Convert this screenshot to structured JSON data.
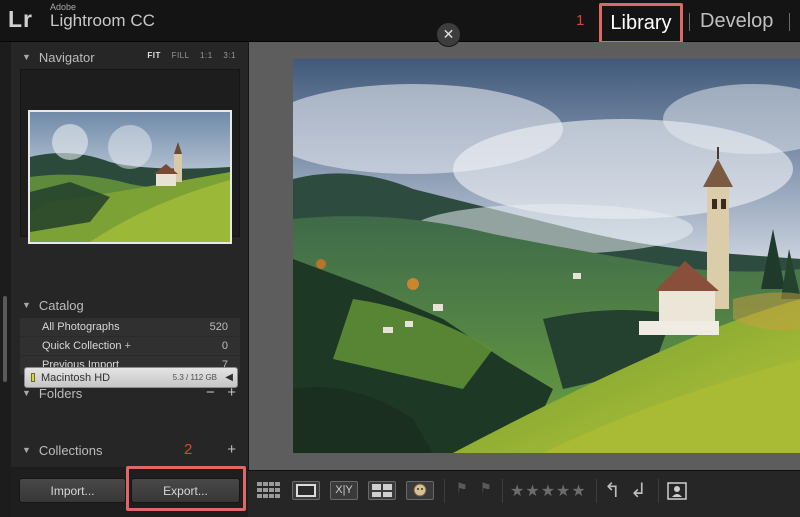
{
  "app": {
    "logo_mark": "Lr",
    "brand_small": "Adobe",
    "brand_name": "Lightroom CC"
  },
  "modules": {
    "library": "Library",
    "develop": "Develop"
  },
  "annotations": {
    "step1": "1",
    "step2": "2"
  },
  "navigator": {
    "title": "Navigator",
    "modes": [
      "FIT",
      "FILL",
      "1:1",
      "3:1"
    ]
  },
  "catalog": {
    "title": "Catalog",
    "items": [
      {
        "label": "All Photographs",
        "count": "520"
      },
      {
        "label": "Quick Collection",
        "plus": "+",
        "count": "0"
      },
      {
        "label": "Previous Import",
        "count": "7"
      }
    ]
  },
  "folders": {
    "title": "Folders",
    "minus": "−",
    "plus": "+",
    "volume": {
      "name": "Macintosh HD",
      "size": "5.3 / 112 GB"
    }
  },
  "collections": {
    "title": "Collections",
    "plus": "+"
  },
  "buttons": {
    "import": "Import...",
    "export": "Export..."
  },
  "toolbar": {
    "grid_letters": "X|Y",
    "stars": "★★★★★"
  },
  "icons": {
    "close": "close-icon",
    "disclosure": "triangle-down-icon",
    "grid": "grid-view-icon",
    "loupe": "loupe-view-icon",
    "compare": "compare-view-icon",
    "survey": "survey-view-icon",
    "people": "people-view-icon",
    "rotate_left": "rotate-left-icon",
    "rotate_right": "rotate-right-icon",
    "crop": "crop-icon"
  },
  "colors": {
    "highlight": "#e06767",
    "annotation": "#d9453c"
  }
}
